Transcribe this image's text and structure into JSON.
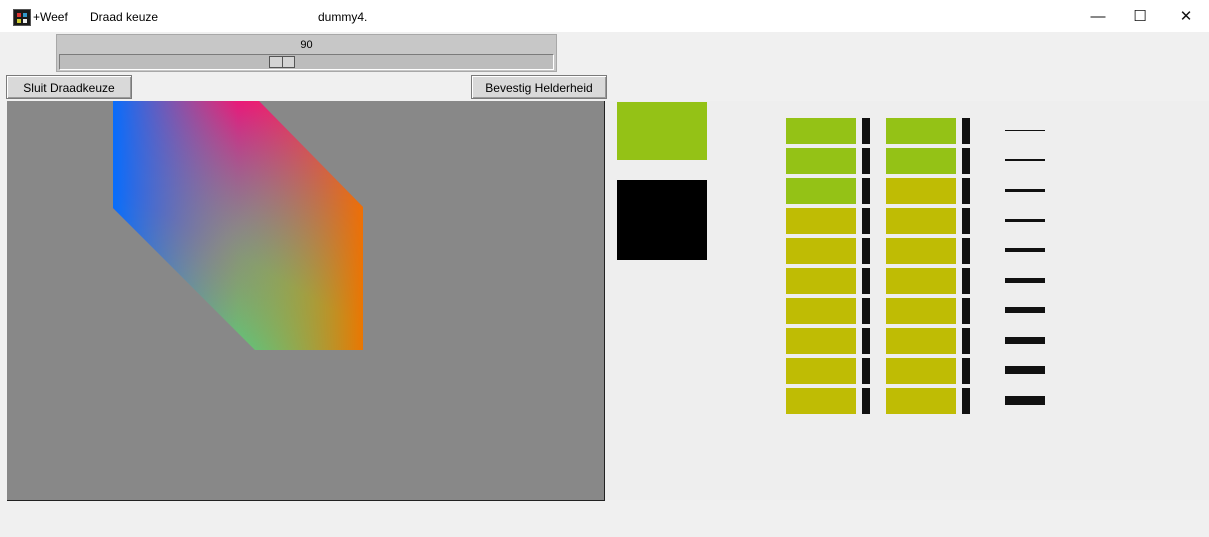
{
  "titlebar": {
    "icon": "app-icon",
    "menu_weef": "+Weef",
    "menu_draad": "Draad keuze",
    "title": "dummy4.",
    "minimize_glyph": "—",
    "maximize_glyph": "☐",
    "close_glyph": "✕"
  },
  "slider": {
    "value_label": "90",
    "value": 90,
    "min": 0,
    "max": 200
  },
  "buttons": {
    "close_thread_choice": "Sluit Draadkeuze",
    "confirm_brightness": "Bevestig Helderheid"
  },
  "colors": {
    "selected_swatch": "#94c216",
    "secondary_swatch": "#000000",
    "wire_green": "#94c216",
    "wire_olive": "#bfbc04",
    "gray_canvas": "#888888"
  },
  "wires": {
    "column1": [
      "green",
      "green",
      "green",
      "olive",
      "olive",
      "olive",
      "olive",
      "olive",
      "olive",
      "olive"
    ],
    "column2": [
      "green",
      "green",
      "olive",
      "olive",
      "olive",
      "olive",
      "olive",
      "olive",
      "olive",
      "olive"
    ]
  },
  "thickness_samples": [
    1,
    2,
    3,
    3,
    4,
    5,
    6,
    7,
    8,
    9
  ]
}
